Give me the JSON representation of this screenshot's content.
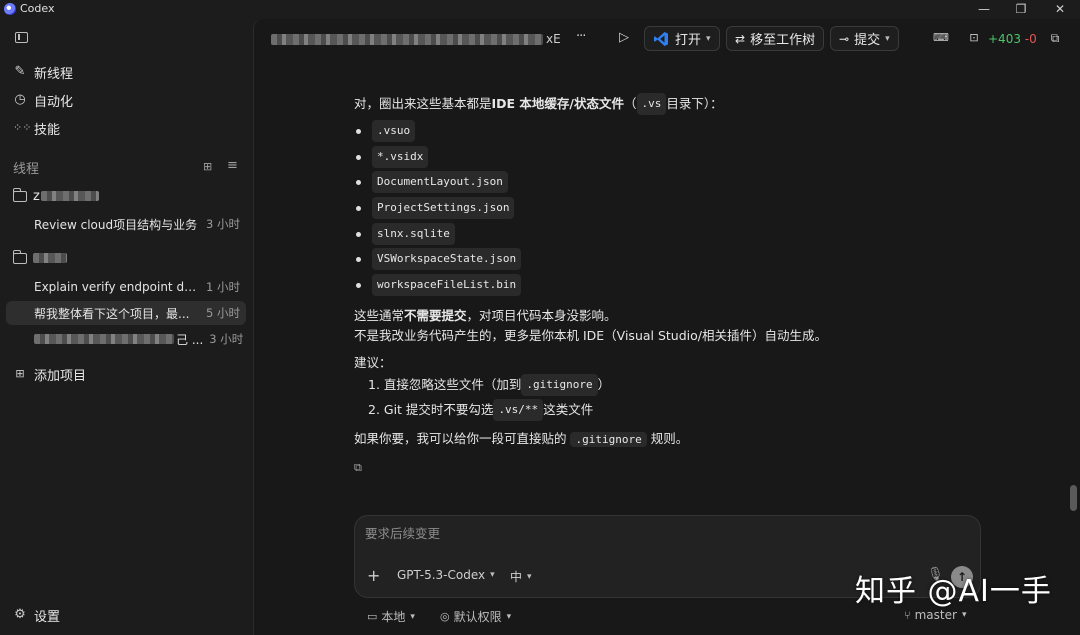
{
  "window": {
    "title": "Codex"
  },
  "sidebar": {
    "new_thread": "新线程",
    "automation": "自动化",
    "skills": "技能",
    "threads_header": "线程",
    "projects": [
      {
        "name_prefix": "z",
        "threads": [
          {
            "title": "Review cloud项目结构与业务",
            "time": "3 小时"
          }
        ]
      },
      {
        "name_prefix": "",
        "threads": [
          {
            "title": "Explain verify endpoint data...",
            "time": "1 小时"
          },
          {
            "title": "帮我整体看下这个项目，最...",
            "time": "5 小时",
            "active": true
          },
          {
            "title_suffix": "己 ...",
            "time": "3 小时"
          }
        ]
      }
    ],
    "add_project": "添加项目",
    "settings": "设置"
  },
  "toolbar": {
    "title_tail": "xE",
    "more": "···",
    "open_label": "打开",
    "worktree_label": "移至工作树",
    "commit_label": "提交",
    "diff_added": "+403",
    "diff_removed": "-0"
  },
  "message": {
    "intro_before": "对，圈出来这些基本都是 ",
    "intro_bold": "IDE 本地缓存/状态文件",
    "intro_paren_open": "（",
    "intro_code": ".vs",
    "intro_after": " 目录下）：",
    "files": [
      ".vsuo",
      "*.vsidx",
      "DocumentLayout.json",
      "ProjectSettings.json",
      "slnx.sqlite",
      "VSWorkspaceState.json",
      "workspaceFileList.bin"
    ],
    "para1_before": "这些通常",
    "para1_bold": "不需要提交",
    "para1_after": "，对项目代码本身没影响。",
    "para2": "不是我改业务代码产生的，更多是你本机 IDE（Visual Studio/相关插件）自动生成。",
    "suggest_label": "建议：",
    "step1_before": "1. 直接忽略这些文件（加到 ",
    "step1_code": ".gitignore",
    "step1_after": " ）",
    "step2_before": "2. Git 提交时不要勾选 ",
    "step2_code": ".vs/**",
    "step2_after": " 这类文件",
    "closing_before": "如果你要，我可以给你一段可直接贴的 ",
    "closing_code": ".gitignore",
    "closing_after": " 规则。"
  },
  "composer": {
    "placeholder": "要求后续变更",
    "add": "+",
    "model": "GPT-5.3-Codex",
    "effort": "中"
  },
  "footer": {
    "env": "本地",
    "permissions": "默认权限",
    "branch": "master"
  },
  "watermark": "知乎 @AI一手",
  "colors": {
    "added": "#4ec36a",
    "removed": "#e05555",
    "accent_vs": "#2f7ff0"
  }
}
